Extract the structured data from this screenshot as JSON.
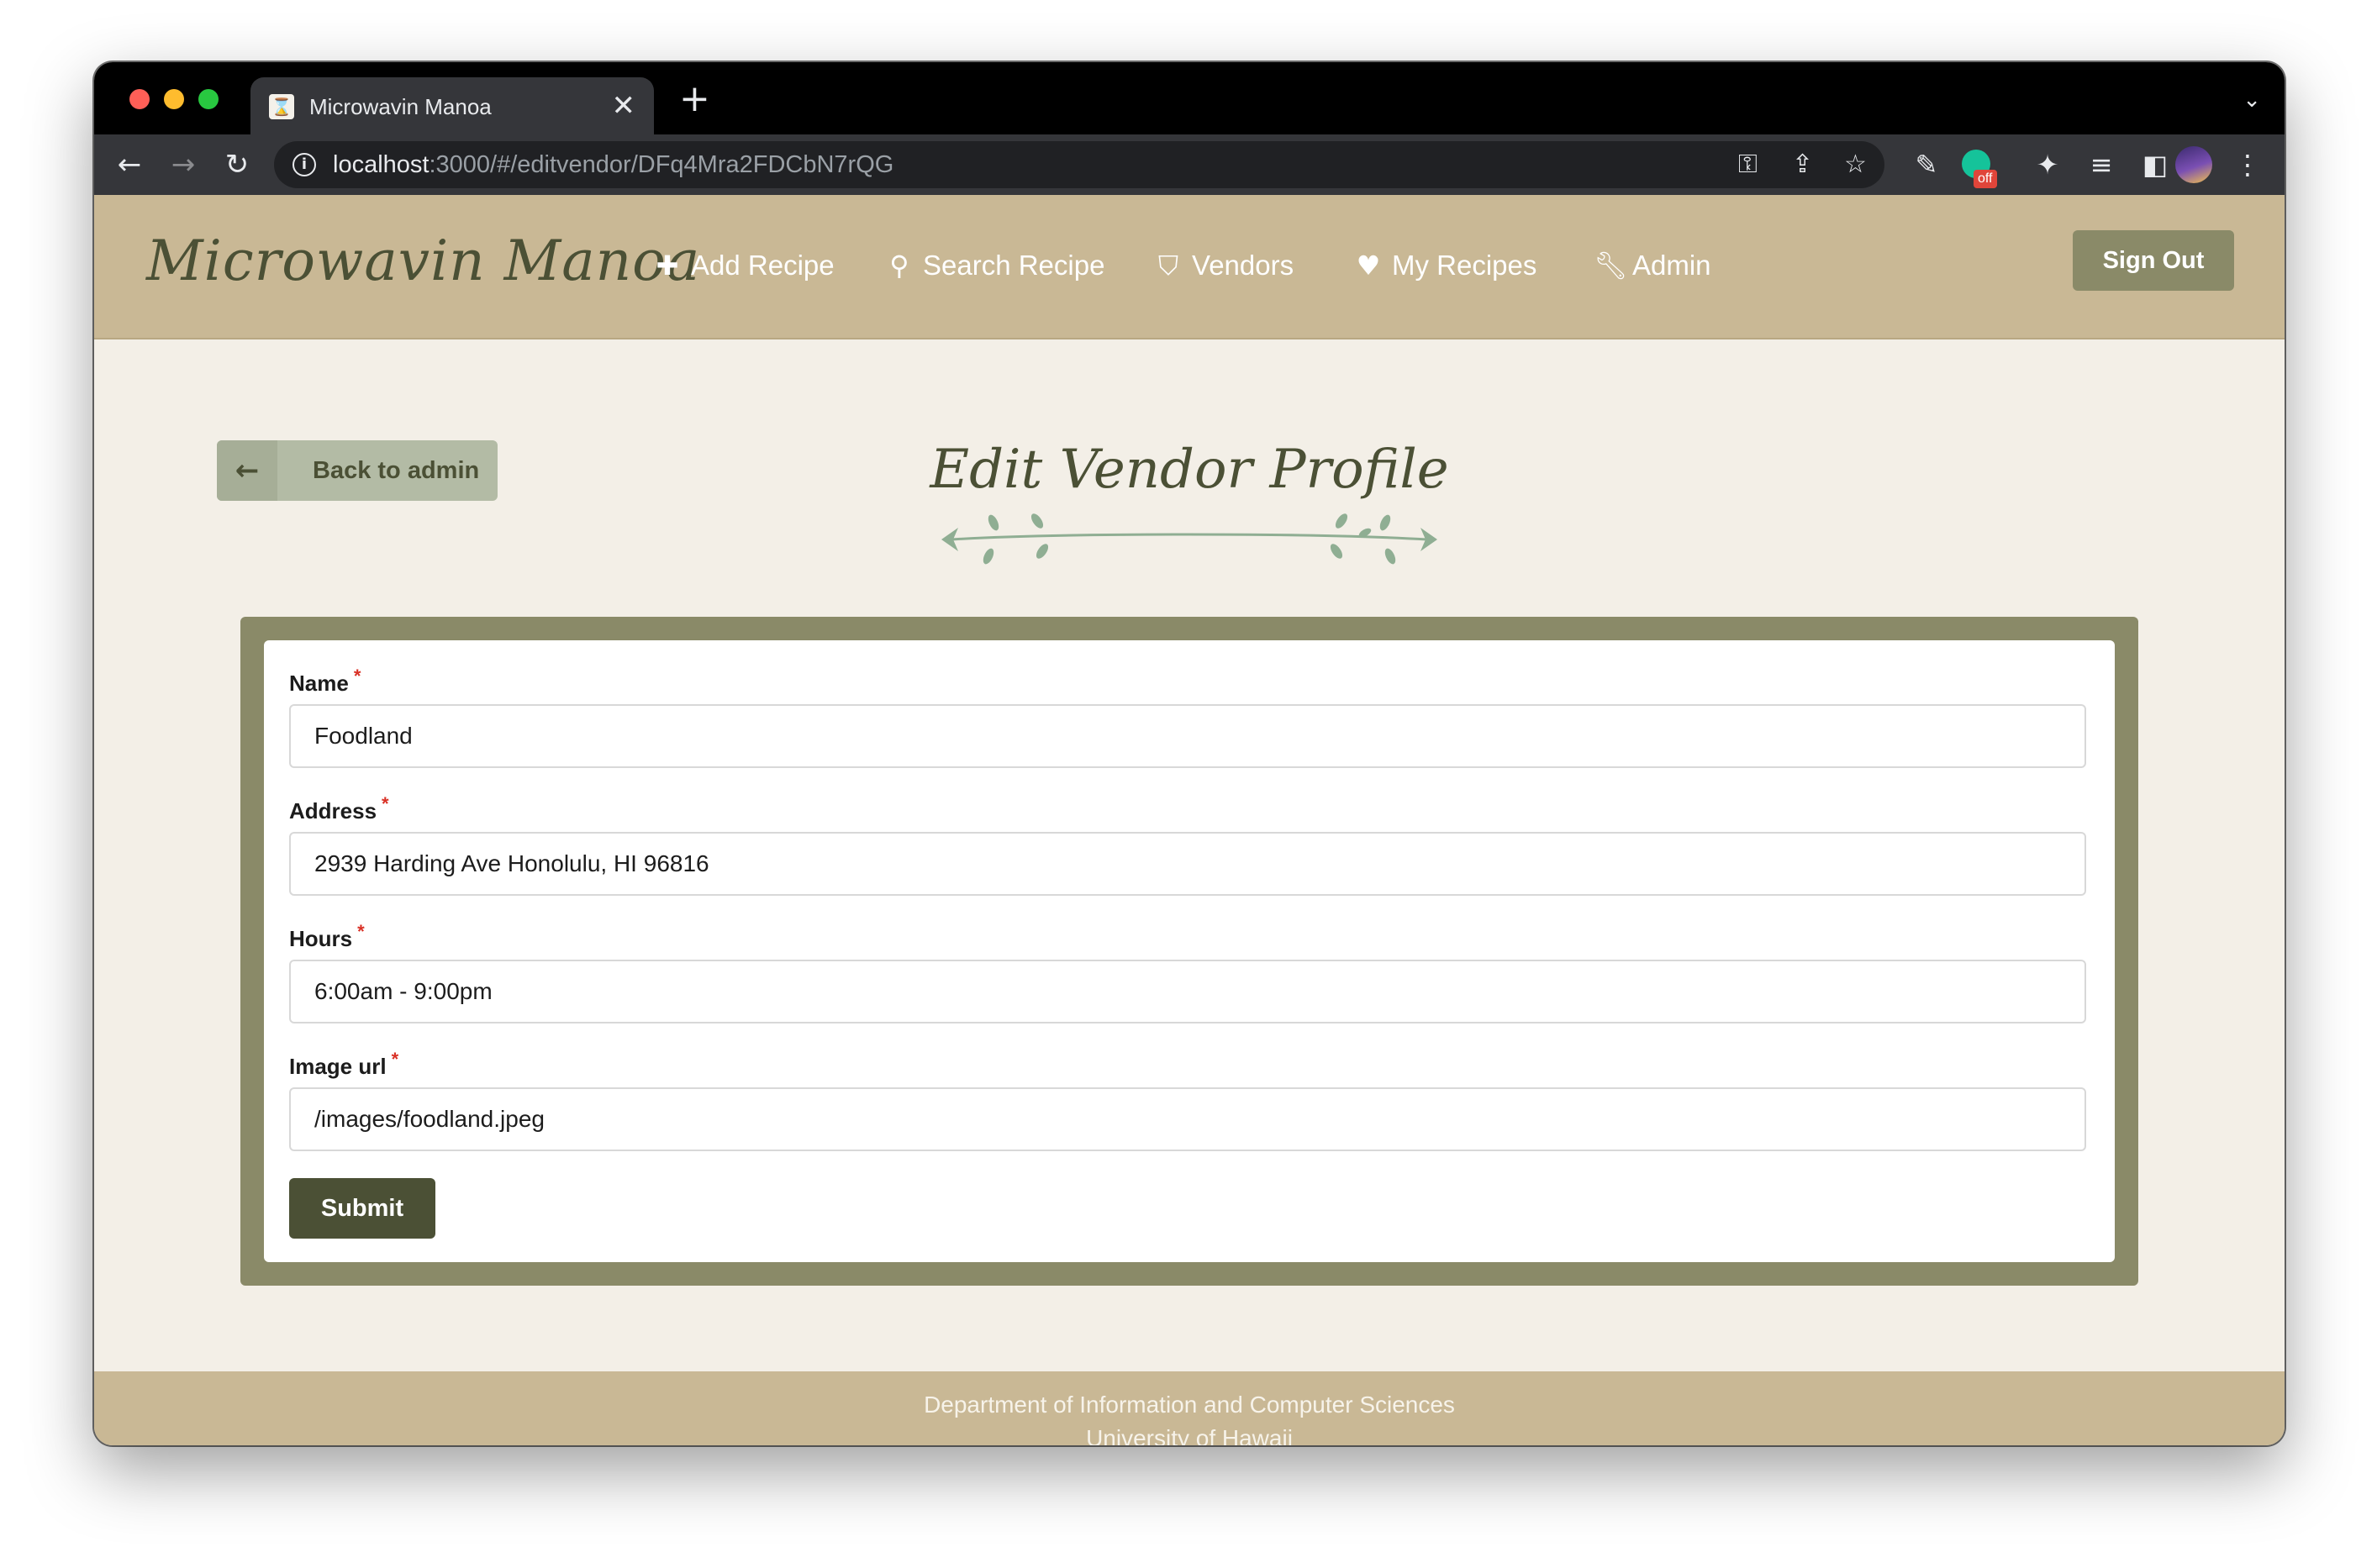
{
  "browser": {
    "tab_title": "Microwavin Manoa",
    "tab_close": "✕",
    "new_tab": "+",
    "url_host": "localhost",
    "url_path": ":3000/#/editvendor/DFq4Mra2FDCbN7rQG",
    "grammarly_badge": "off"
  },
  "navbar": {
    "brand": "Microwavin Manoa",
    "items": [
      {
        "label": "Add Recipe",
        "icon": "plus-icon"
      },
      {
        "label": "Search Recipe",
        "icon": "search-icon"
      },
      {
        "label": "Vendors",
        "icon": "tags-icon"
      },
      {
        "label": "My Recipes",
        "icon": "heart-icon"
      },
      {
        "label": "Admin",
        "icon": "wrench-icon"
      }
    ],
    "sign_out": "Sign Out"
  },
  "main": {
    "back_button": "Back to admin",
    "title": "Edit Vendor Profile",
    "form": {
      "fields": [
        {
          "label": "Name",
          "value": "Foodland",
          "required": "*"
        },
        {
          "label": "Address",
          "value": "2939 Harding Ave Honolulu, HI 96816",
          "required": "*"
        },
        {
          "label": "Hours",
          "value": "6:00am - 9:00pm",
          "required": "*"
        },
        {
          "label": "Image url",
          "value": "/images/foodland.jpeg",
          "required": "*"
        }
      ],
      "submit": "Submit"
    }
  },
  "footer": {
    "line1": "Department of Information and Computer Sciences",
    "line2": "University of Hawaii"
  },
  "colors": {
    "navbar_bg": "#c9b895",
    "brand_text": "#4b5035",
    "form_frame": "#8a8a68",
    "page_bg": "#f3efe7",
    "submit_bg": "#4b5035",
    "required_star": "#d93025"
  }
}
